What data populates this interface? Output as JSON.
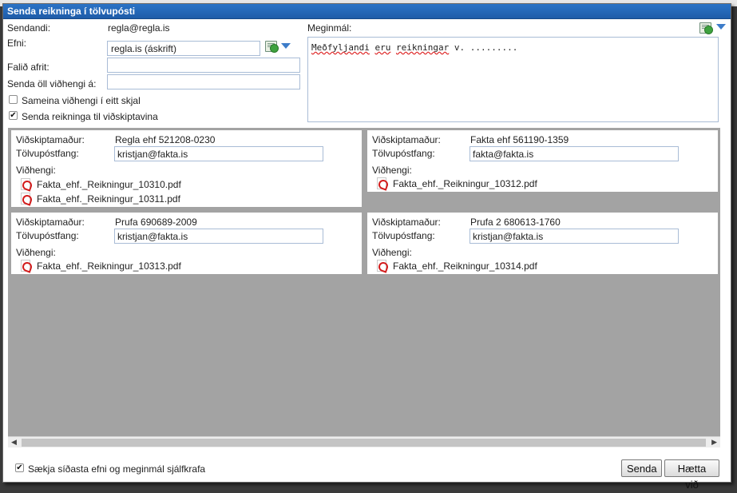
{
  "dialog": {
    "title": "Senda reikninga í tölvupósti"
  },
  "form": {
    "sender_label": "Sendandi:",
    "sender_value": "regla@regla.is",
    "subject_label": "Efni:",
    "subject_value": "regla.is (áskrift)",
    "bcc_label": "Falið afrit:",
    "bcc_value": "",
    "send_all_label": "Senda öll viðhengi á:",
    "send_all_value": "",
    "combine_label": "Sameina viðhengi í eitt skjal",
    "combine_checked": false,
    "send_customers_label": "Senda reikninga til viðskiptavina",
    "send_customers_checked": true,
    "body_label": "Meginmál:",
    "body_word1": "Meðfyljandi",
    "body_word2": "eru",
    "body_word3": "reikningar",
    "body_rest": " v. ........."
  },
  "icons": {
    "template_icon": "insert-template-icon",
    "dropdown_icon": "chevron-down-icon",
    "attachment_icon": "pdf-icon"
  },
  "customers": [
    {
      "customer_label": "Viðskiptamaður:",
      "customer": "Regla ehf 521208-0230",
      "email_label": "Tölvupóstfang:",
      "email": "kristjan@fakta.is",
      "attach_label": "Viðhengi:",
      "attachments": [
        "Fakta_ehf._Reikningur_10310.pdf",
        "Fakta_ehf._Reikningur_10311.pdf"
      ]
    },
    {
      "customer_label": "Viðskiptamaður:",
      "customer": "Fakta ehf 561190-1359",
      "email_label": "Tölvupóstfang:",
      "email": "fakta@fakta.is",
      "attach_label": "Viðhengi:",
      "attachments": [
        "Fakta_ehf._Reikningur_10312.pdf"
      ]
    },
    {
      "customer_label": "Viðskiptamaður:",
      "customer": "Prufa 690689-2009",
      "email_label": "Tölvupóstfang:",
      "email": "kristjan@fakta.is",
      "attach_label": "Viðhengi:",
      "attachments": [
        "Fakta_ehf._Reikningur_10313.pdf"
      ]
    },
    {
      "customer_label": "Viðskiptamaður:",
      "customer": "Prufa 2 680613-1760",
      "email_label": "Tölvupóstfang:",
      "email": "kristjan@fakta.is",
      "attach_label": "Viðhengi:",
      "attachments": [
        "Fakta_ehf._Reikningur_10314.pdf"
      ]
    }
  ],
  "footer": {
    "autofill_label": "Sækja síðasta efni og meginmál sjálfkrafa",
    "autofill_checked": true,
    "send_label": "Senda",
    "cancel_label": "Hætta við"
  },
  "colors": {
    "titlebar": "#1e5ca8",
    "grid_background": "#a3a3a3"
  }
}
